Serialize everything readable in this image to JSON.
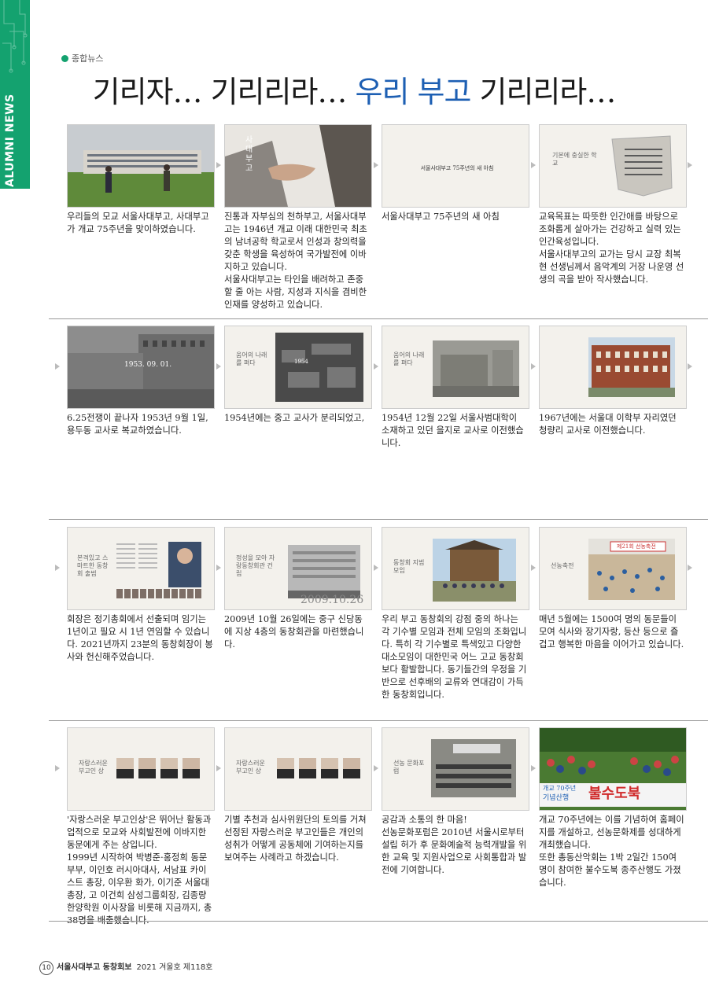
{
  "sidebar": {
    "label": "ALUMNI NEWS"
  },
  "section": {
    "label": "종합뉴스"
  },
  "headline": {
    "part1": "기리자… 기리리라… ",
    "accent": "우리 부고",
    "part2": " 기리리라…"
  },
  "row1": [
    {
      "caption": "우리들의 모교 서울사대부고, 사대부고가 개교 75주년을 맞이하였습니다."
    },
    {
      "caption": "진통과 자부심의 천하부고, 서울사대부고는 1946년 개교 이래 대한민국 최초의 남녀공학 학교로서 인성과 창의력을 갖춘 학생을 육성하여 국가발전에 이바지하고 있습니다.\n서울사대부고는 타인을 배려하고 존중할 줄 아는 사람, 지성과 지식을 겸비한 인재를 양성하고 있습니다.",
      "slide": "사 대 부 고"
    },
    {
      "caption": "서울사대부고 75주년의 새 아침",
      "slide": "서울사대부고 75주년의 새 아침"
    },
    {
      "caption": "교육목표는 따뜻한 인간애를 바탕으로 조화롭게 살아가는 건강하고 실력 있는 인간육성입니다.\n서울사대부고의 교가는 당시 교장 최복현 선생님께서 음악계의 거장 나운영 선생의 곡을 받아 작사했습니다.",
      "slide": "기본에 충실한 학교"
    }
  ],
  "row2": [
    {
      "caption": "6.25전쟁이 끝나자 1953년 9월 1일, 용두동 교사로 복교하였습니다.",
      "slide": "1953. 09. 01."
    },
    {
      "caption": "1954년에는 중고 교사가 분리되었고,",
      "slide": "움어의 나래를 펴다",
      "year": "1954"
    },
    {
      "caption": "1954년 12월 22일 서울사범대학이 소재하고 있던 을지로 교사로 이전했습니다.",
      "slide": "움어의 나래를 펴다"
    },
    {
      "caption": "1967년에는 서울대 이학부 자리였던 청량리 교사로 이전했습니다."
    }
  ],
  "row3": [
    {
      "caption": "회장은 정기총회에서 선출되며 임기는 1년이고 필요 시 1년 연임할 수 있습니다. 2021년까지 23분의 동창회장이 봉사와 헌신해주었습니다.",
      "slide": "본격있고 스마트한 동창회 출범"
    },
    {
      "caption": "2009년 10월 26일에는 중구 신당동에 지상 4층의 동창회관을 마련했습니다.",
      "slide": "정성을 모아 자랑동창회관 건립",
      "date": "2009.10.26"
    },
    {
      "caption": "우리 부고 동창회의 강점 중의 하나는 각 기수별 모임과 전체 모임의 조화입니다. 특히 각 기수별로 특색있고 다양한 대소모임이 대한민국 어느 고교 동창회보다 활발합니다. 동기들간의 우정을 기반으로 선후배의 교류와 연대감이 가득한 동창회입니다.",
      "slide": "동창회 지범모임"
    },
    {
      "caption": "매년 5월에는 1500여 명의 동문들이 모여 식사와 장기자랑, 등산 등으로 즐겁고 행복한 마음을 이어가고 있습니다.",
      "slide": "선농축전",
      "banner": "제21회 선농축전"
    }
  ],
  "row4": [
    {
      "caption": "'자랑스러운 부고인상'은 뛰어난 활동과 업적으로 모교와 사회발전에 이바지한 동문에게 주는 상입니다.\n1999년 시작하여 박병준·홍정희 동문 부부, 이인호 러시아대사, 서남표 카이스트 총장, 이우환 화가, 이기준 서울대 총장, 고 이건희 삼성그룹회장, 김종량 한양학원 이사장을 비롯해 지금까지, 총 38명을 배출했습니다.",
      "slide": "자랑스러운 부고인 상"
    },
    {
      "caption": "기별 추천과 심사위원단의 토의를 거쳐 선정된 자랑스러운 부고인들은 개인의 성취가 어떻게 공동체에 기여하는지를 보여주는 사례라고 하겠습니다.",
      "slide": "자랑스러운 부고인 상"
    },
    {
      "caption": "공감과 소통의 한 마음!\n선농문화포럼은 2010년 서울시로부터 설립 허가 후 문화예술적 능력개발을 위한 교육 및 지원사업으로 사회통합과 발전에 기여합니다.",
      "slide": "선농 문화포럼"
    },
    {
      "caption": "개교 70주년에는 이를 기념하여 홈페이지를 개설하고, 선농문화제를 성대하게 개최했습니다.\n또한 총동산악회는 1박 2일간 150여 명이 참여한 불수도북 종주산행도 가졌습니다.",
      "banner1": "개교 70주년",
      "banner2": "기념산행",
      "banner3": "불수도북"
    }
  ],
  "footer": {
    "page": "10",
    "publication": "서울사대부고 동창회보",
    "issue": "2021 겨울호 제118호"
  },
  "colors": {
    "brand_green": "#14a26f",
    "accent_blue": "#1d5fb3"
  }
}
